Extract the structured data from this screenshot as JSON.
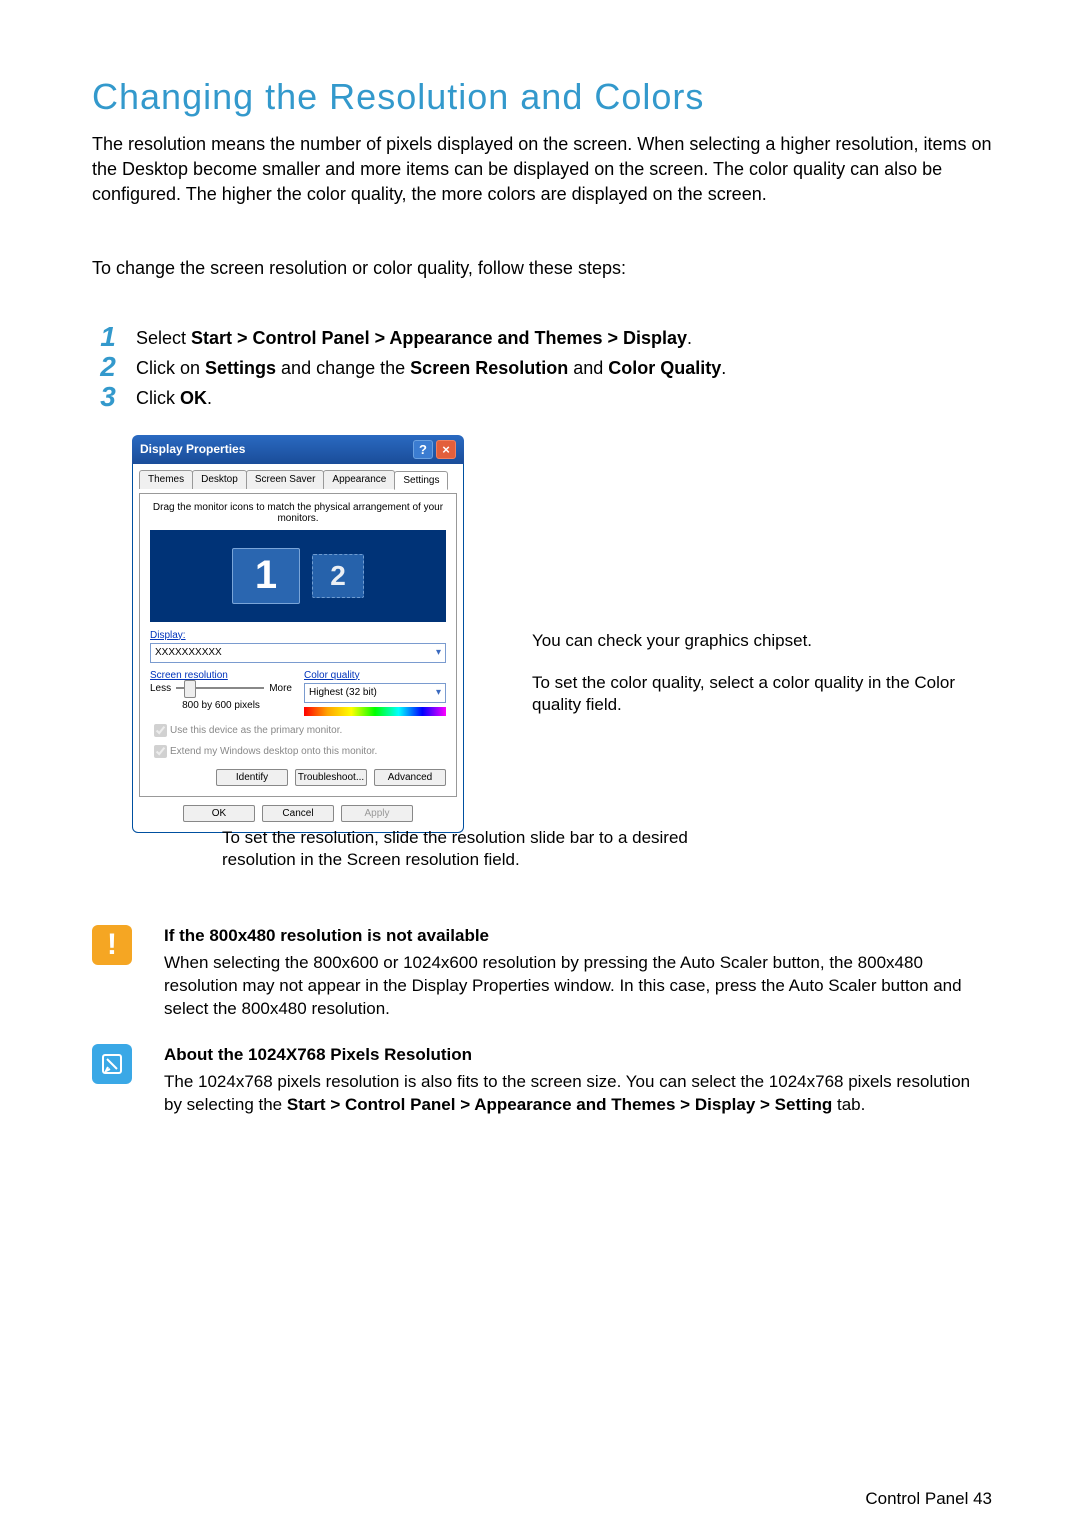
{
  "heading": "Changing the Resolution and Colors",
  "intro": "The resolution means the number of pixels displayed on the screen. When selecting a higher resolution, items on the Desktop become smaller and more items can be displayed on the screen. The color quality can also be configured. The higher the color quality, the more colors are displayed on the screen.",
  "lead": "To change the screen resolution or color quality, follow these steps:",
  "steps": {
    "s1_pre": "Select ",
    "s1_path": "Start > Control Panel > Appearance and Themes > Display",
    "s1_post": ".",
    "s2_pre": "Click on ",
    "s2_b1": "Settings",
    "s2_mid1": " and change the ",
    "s2_b2": "Screen Resolution",
    "s2_mid2": " and ",
    "s2_b3": "Color Quality",
    "s2_post": ".",
    "s3_pre": "Click ",
    "s3_b": "OK",
    "s3_post": "."
  },
  "dlg": {
    "title": "Display Properties",
    "tabs": {
      "t1": "Themes",
      "t2": "Desktop",
      "t3": "Screen Saver",
      "t4": "Appearance",
      "t5": "Settings"
    },
    "hint": "Drag the monitor icons to match the physical arrangement of your monitors.",
    "mon1": "1",
    "mon2": "2",
    "display_lbl": "Display:",
    "display_val": "XXXXXXXXXX",
    "sres_lbl": "Screen resolution",
    "less": "Less",
    "more": "More",
    "resval": "800 by 600 pixels",
    "cq_lbl": "Color quality",
    "cq_val": "Highest (32 bit)",
    "chk1": "Use this device as the primary monitor.",
    "chk2": "Extend my Windows desktop onto this monitor.",
    "identify": "Identify",
    "trouble": "Troubleshoot...",
    "advanced": "Advanced",
    "ok": "OK",
    "cancel": "Cancel",
    "apply": "Apply"
  },
  "callouts": {
    "c1": "You can check your graphics chipset.",
    "c2": "To set the color quality, select a color quality in the Color quality field.",
    "c3": "To set the resolution, slide the resolution slide bar to a desired resolution in the Screen resolution field."
  },
  "note1": {
    "title": "If the 800x480 resolution is not available",
    "body": "When selecting the 800x600 or 1024x600 resolution by pressing the Auto Scaler button, the 800x480 resolution may not appear in the Display Properties window. In this case, press the Auto Scaler button and select the 800x480 resolution."
  },
  "note2": {
    "title": "About the 1024X768 Pixels Resolution",
    "pre": "The 1024x768 pixels resolution is also fits to the screen size. You can select the 1024x768 pixels resolution by selecting the ",
    "path": "Start > Control Panel > Appearance and Themes > Display > Setting",
    "post": " tab."
  },
  "footer": {
    "section": "Control Panel ",
    "page": "43"
  }
}
